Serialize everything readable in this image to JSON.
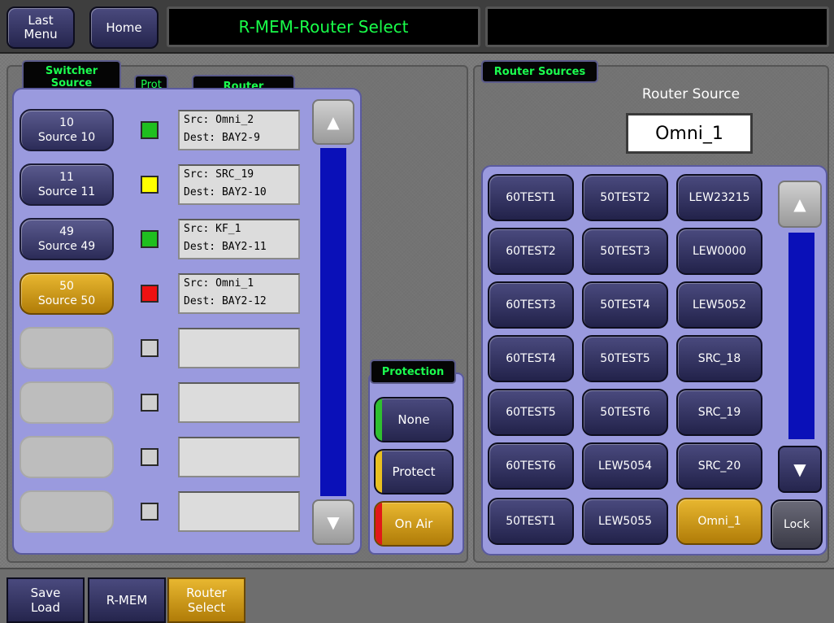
{
  "header": {
    "last_menu_label": "Last\nMenu",
    "home_label": "Home",
    "title": "R-MEM-Router Select",
    "secondary_title": ""
  },
  "left_panel": {
    "switcher_source_label": "Switcher\nSource",
    "prot_label": "Prot",
    "router_label": "Router",
    "rows": [
      {
        "num": "10",
        "name": "Source 10",
        "prot_color": "#1fbf1f",
        "src": "Src: Omni_2",
        "dest": "Dest: BAY2-9",
        "selected": false,
        "empty": false
      },
      {
        "num": "11",
        "name": "Source 11",
        "prot_color": "#ffff00",
        "src": "Src: SRC_19",
        "dest": "Dest: BAY2-10",
        "selected": false,
        "empty": false
      },
      {
        "num": "49",
        "name": "Source 49",
        "prot_color": "#1fbf1f",
        "src": "Src: KF_1",
        "dest": "Dest: BAY2-11",
        "selected": false,
        "empty": false
      },
      {
        "num": "50",
        "name": "Source 50",
        "prot_color": "#ee1111",
        "src": "Src: Omni_1",
        "dest": "Dest: BAY2-12",
        "selected": true,
        "empty": false
      },
      {
        "num": "",
        "name": "",
        "prot_color": "#cfcfcf",
        "src": "",
        "dest": "",
        "selected": false,
        "empty": true
      },
      {
        "num": "",
        "name": "",
        "prot_color": "#cfcfcf",
        "src": "",
        "dest": "",
        "selected": false,
        "empty": true
      },
      {
        "num": "",
        "name": "",
        "prot_color": "#cfcfcf",
        "src": "",
        "dest": "",
        "selected": false,
        "empty": true
      },
      {
        "num": "",
        "name": "",
        "prot_color": "#cfcfcf",
        "src": "",
        "dest": "",
        "selected": false,
        "empty": true
      }
    ]
  },
  "protection": {
    "label": "Protection",
    "options": [
      {
        "label": "None",
        "strip_color": "#2fbf2f",
        "selected": false
      },
      {
        "label": "Protect",
        "strip_color": "#e8c020",
        "selected": false
      },
      {
        "label": "On Air",
        "strip_color": "#e01818",
        "selected": true
      }
    ]
  },
  "router_sources": {
    "panel_label": "Router Sources",
    "source_heading": "Router Source",
    "source_value": "Omni_1",
    "columns": [
      [
        "60TEST1",
        "60TEST2",
        "60TEST3",
        "60TEST4",
        "60TEST5",
        "60TEST6",
        "50TEST1"
      ],
      [
        "50TEST2",
        "50TEST3",
        "50TEST4",
        "50TEST5",
        "50TEST6",
        "LEW5054",
        "LEW5055"
      ],
      [
        "LEW23215",
        "LEW0000",
        "LEW5052",
        "SRC_18",
        "SRC_19",
        "SRC_20",
        "Omni_1"
      ]
    ],
    "selected": "Omni_1",
    "lock_label": "Lock"
  },
  "footer": {
    "tabs": [
      {
        "label": "Save\nLoad",
        "selected": false
      },
      {
        "label": "R-MEM",
        "selected": false
      },
      {
        "label": "Router\nSelect",
        "selected": true
      }
    ]
  },
  "colors": {
    "accent_green": "#1bff4f",
    "panel_lavender": "#9a9ade",
    "selected_gold": "#d79e15",
    "scroll_blue": "#0a10b8"
  }
}
